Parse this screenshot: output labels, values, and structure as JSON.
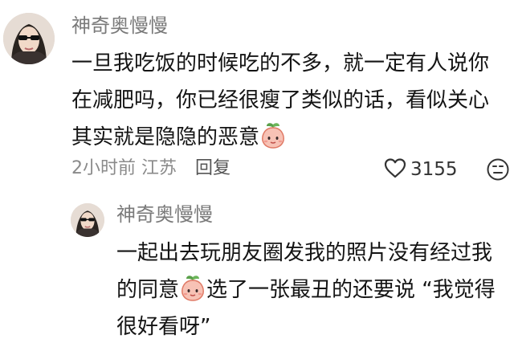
{
  "comment": {
    "username": "神奇奥慢慢",
    "text_parts": [
      "一旦我吃饭的时候吃的不多，就一定有人说你在减肥吗，你已经很瘦了类似的话，看似关心其实就是隐隐的恶意"
    ],
    "emoji": "peach-face-emoji",
    "time": "2小时前",
    "location": "江苏",
    "reply_label": "回复",
    "like_count": "3155",
    "like_icon": "heart-outline-icon",
    "dislike_icon": "meh-face-icon"
  },
  "reply": {
    "username": "神奇奥慢慢",
    "text_before": "一起出去玩朋友圈发我的照片没有经过我的同意",
    "text_after": "选了一张最丑的还要说 “我觉得很好看呀”",
    "emoji": "peach-face-emoji"
  },
  "colors": {
    "username": "#7a7a7a",
    "meta": "#8a8a8a",
    "emoji_fill": "#f7c2b5",
    "emoji_leaf": "#5aa04a"
  }
}
